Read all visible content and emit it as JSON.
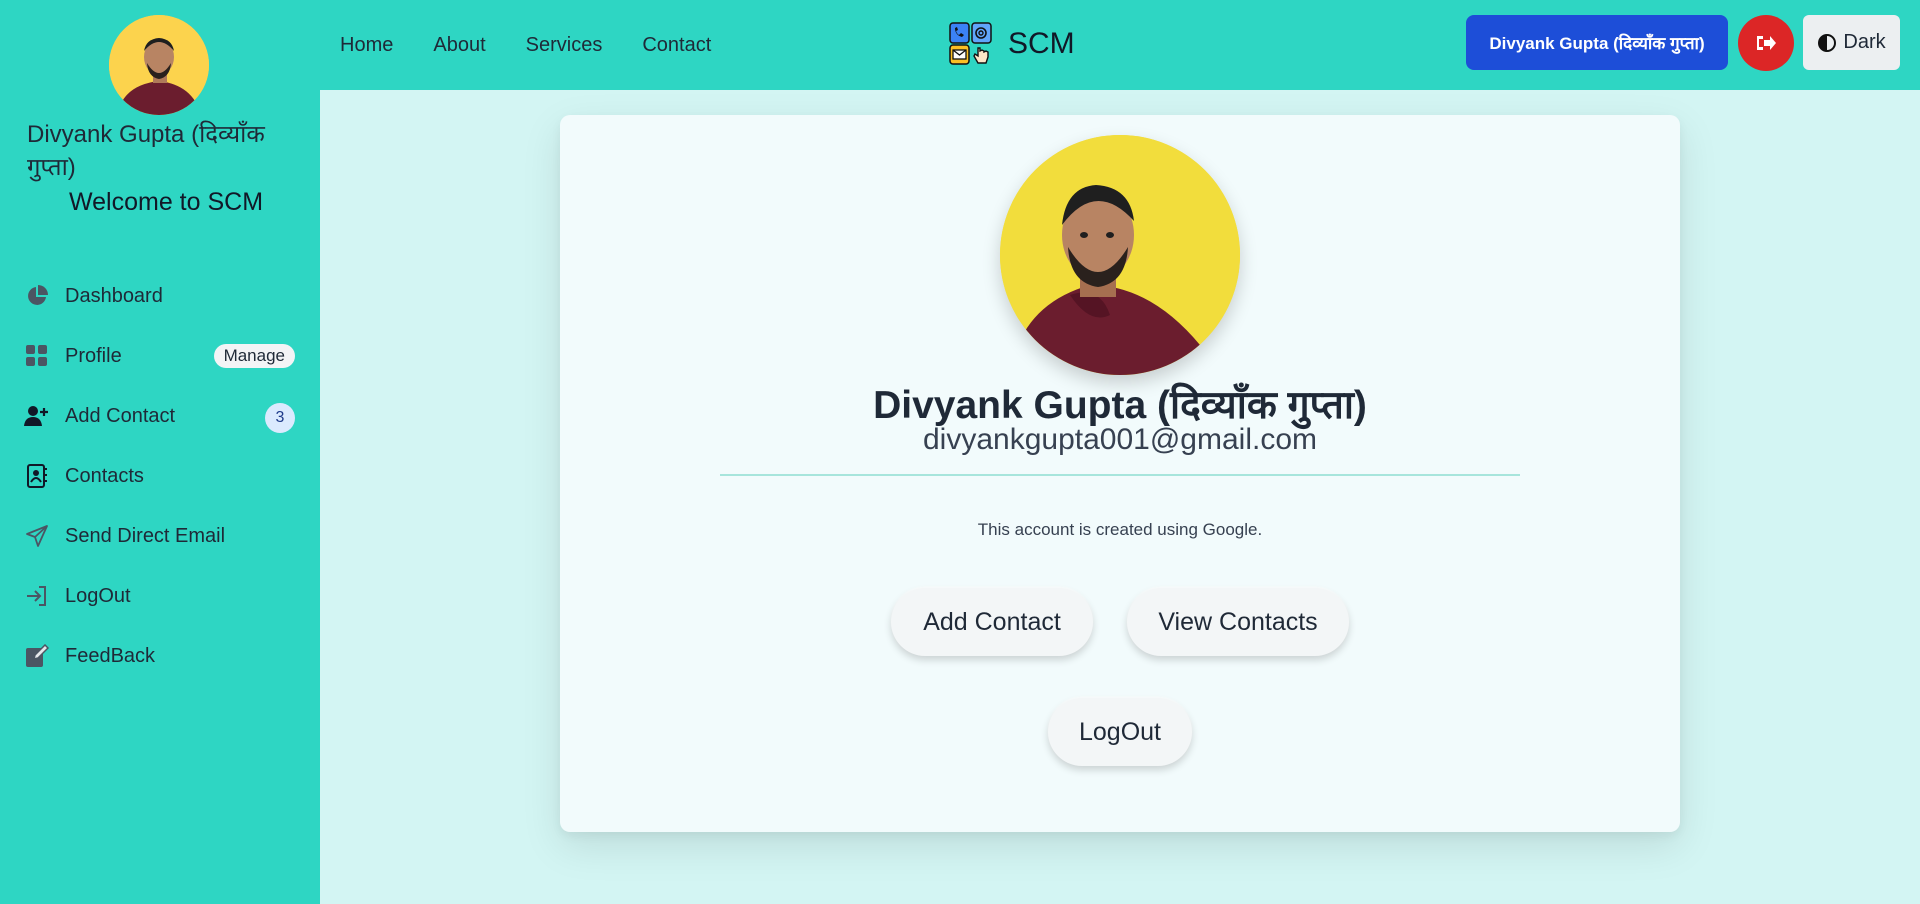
{
  "nav": {
    "links": [
      "Home",
      "About",
      "Services",
      "Contact"
    ],
    "brand": "SCM",
    "user_button": "Divyank Gupta (दिव्याँक गुप्ता)",
    "theme_button": "Dark"
  },
  "sidebar": {
    "user_name": "Divyank Gupta (दिव्याँक गुप्ता)",
    "welcome": "Welcome to SCM",
    "items": [
      {
        "label": "Dashboard",
        "icon": "pie-chart-icon"
      },
      {
        "label": "Profile",
        "icon": "grid-icon",
        "badge": "Manage"
      },
      {
        "label": "Add Contact",
        "icon": "user-plus-icon",
        "badge": "3"
      },
      {
        "label": "Contacts",
        "icon": "address-book-icon"
      },
      {
        "label": "Send Direct Email",
        "icon": "paper-plane-icon"
      },
      {
        "label": "LogOut",
        "icon": "sign-in-icon"
      },
      {
        "label": "FeedBack",
        "icon": "edit-icon"
      }
    ]
  },
  "profile": {
    "name": "Divyank Gupta (दिव्याँक गुप्ता)",
    "email": "divyankgupta001@gmail.com",
    "note": "This account is created using Google.",
    "buttons": {
      "add_contact": "Add Contact",
      "view_contacts": "View Contacts",
      "logout": "LogOut"
    }
  },
  "colors": {
    "accent": "#2ed6c3",
    "background": "#d3f5f3",
    "card": "#f2fbfc",
    "primary_button": "#1d4ed8",
    "danger": "#dc2626"
  }
}
